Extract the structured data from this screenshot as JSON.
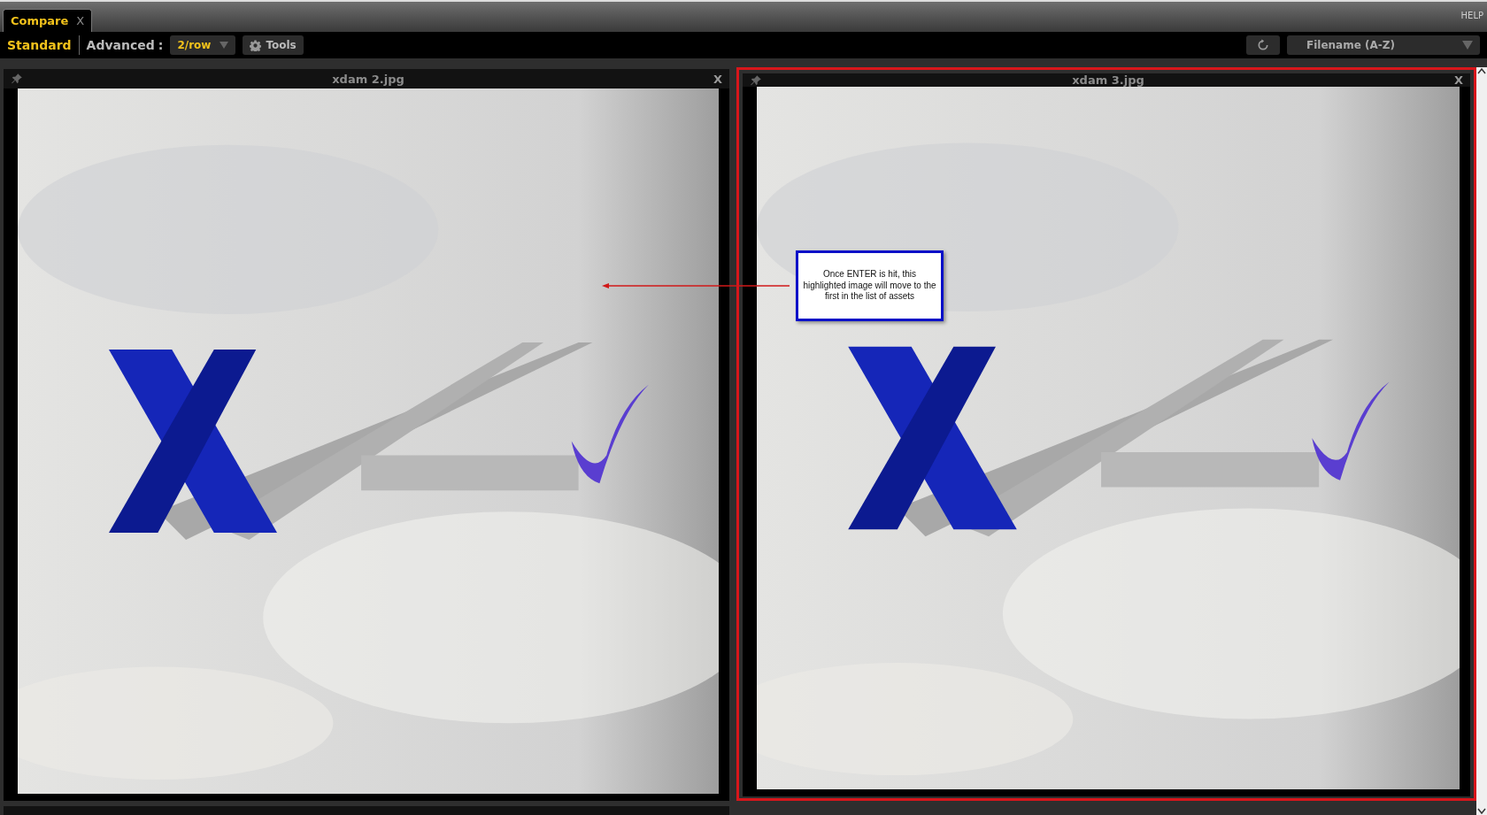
{
  "tabs": [
    {
      "label": "Compare",
      "close": "X",
      "selected": true
    }
  ],
  "help": "HELP",
  "toolbar": {
    "modes": [
      {
        "label": "Standard",
        "selected": true
      },
      {
        "label": "Advanced",
        "selected": false
      }
    ],
    "separator": ":",
    "per_row": "2/row",
    "tools": "Tools",
    "sort": "Filename (A-Z)"
  },
  "cards": [
    {
      "title": "xdam 2.jpg",
      "close": "X",
      "highlighted": false
    },
    {
      "title": "xdam 3.jpg",
      "close": "X",
      "highlighted": true
    }
  ],
  "callout": {
    "text": "Once ENTER is hit, this highlighted image will move to the first in the list of assets"
  }
}
